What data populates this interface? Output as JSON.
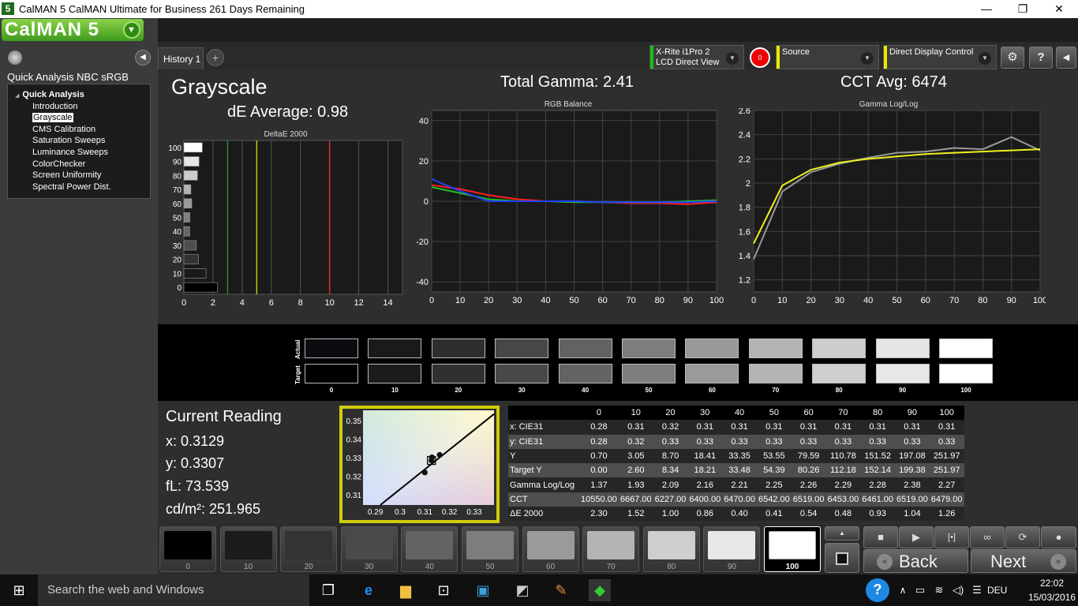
{
  "window": {
    "title": "CalMAN 5 CalMAN Ultimate for Business 261 Days Remaining",
    "minimize": "—",
    "maximize": "❐",
    "close": "✕"
  },
  "brand": {
    "name": "CalMAN 5"
  },
  "sidebar": {
    "workflow_title": "Quick Analysis NBC sRGB",
    "root": "Quick Analysis",
    "items": [
      {
        "label": "Introduction"
      },
      {
        "label": "Grayscale"
      },
      {
        "label": "CMS Calibration"
      },
      {
        "label": "Saturation Sweeps"
      },
      {
        "label": "Luminance Sweeps"
      },
      {
        "label": "ColorChecker"
      },
      {
        "label": "Screen Uniformity"
      },
      {
        "label": "Spectral Power Dist."
      }
    ]
  },
  "tabs": {
    "history": "History 1",
    "add": "+"
  },
  "devices": {
    "meter_line1": "X-Rite i1Pro 2",
    "meter_line2": "LCD Direct View",
    "badge": "0",
    "source": "Source",
    "display": "Direct Display Control"
  },
  "header": {
    "page_title": "Grayscale",
    "de_average": "dE Average: 0.98",
    "total_gamma": "Total Gamma: 2.41",
    "cct_avg": "CCT Avg: 6474"
  },
  "charts": {
    "deltae": {
      "title": "DeltaE 2000"
    },
    "rgb": {
      "title": "RGB Balance"
    },
    "gamma": {
      "title": "Gamma Log/Log"
    }
  },
  "chart_data": [
    {
      "type": "bar",
      "title": "DeltaE 2000",
      "orientation": "horizontal",
      "categories": [
        "0",
        "10",
        "20",
        "30",
        "40",
        "50",
        "60",
        "70",
        "80",
        "90",
        "100"
      ],
      "values": [
        2.3,
        1.52,
        1.0,
        0.86,
        0.4,
        0.41,
        0.54,
        0.48,
        0.93,
        1.04,
        1.26
      ],
      "xlim": [
        0,
        15
      ],
      "xticks": [
        "0",
        "2",
        "4",
        "6",
        "8",
        "10",
        "12",
        "14"
      ],
      "thresholds": [
        {
          "value": 3,
          "color": "#2e8b2e"
        },
        {
          "value": 5,
          "color": "#c8c800"
        },
        {
          "value": 10,
          "color": "#e03030"
        }
      ]
    },
    {
      "type": "line",
      "title": "RGB Balance",
      "x": [
        0,
        10,
        20,
        30,
        40,
        50,
        60,
        70,
        80,
        90,
        100
      ],
      "xticks": [
        "0",
        "10",
        "20",
        "30",
        "40",
        "50",
        "60",
        "70",
        "80",
        "90",
        "100"
      ],
      "yticks": [
        "40",
        "20",
        "0",
        "-20",
        "-40"
      ],
      "ylim": [
        -45,
        45
      ],
      "series": [
        {
          "color": "#ff2020",
          "values": [
            8,
            6,
            3,
            1,
            0,
            0,
            -0.5,
            -1,
            -1,
            -1.5,
            -0.5
          ]
        },
        {
          "color": "#20c020",
          "values": [
            7,
            4,
            1,
            0,
            0,
            -0.5,
            -0.5,
            -0.5,
            -0.5,
            0,
            0.5
          ]
        },
        {
          "color": "#2040ff",
          "values": [
            11,
            5,
            0,
            0,
            0,
            0,
            -0.5,
            -0.5,
            -0.5,
            -0.5,
            0
          ]
        }
      ]
    },
    {
      "type": "line",
      "title": "Gamma Log/Log",
      "x": [
        0,
        10,
        20,
        30,
        40,
        50,
        60,
        70,
        80,
        90,
        100
      ],
      "xticks": [
        "0",
        "10",
        "20",
        "30",
        "40",
        "50",
        "60",
        "70",
        "80",
        "90",
        "100"
      ],
      "yticks": [
        "2.6",
        "2.4",
        "2.2",
        "2",
        "1.8",
        "1.6",
        "1.4",
        "1.2"
      ],
      "ylim": [
        1.1,
        2.6
      ],
      "series": [
        {
          "color": "#9a9a9a",
          "values": [
            1.37,
            1.93,
            2.09,
            2.16,
            2.21,
            2.25,
            2.26,
            2.29,
            2.28,
            2.38,
            2.27
          ]
        },
        {
          "color": "#f0f020",
          "values": [
            1.5,
            1.98,
            2.11,
            2.17,
            2.2,
            2.22,
            2.24,
            2.25,
            2.26,
            2.27,
            2.28
          ]
        }
      ]
    },
    {
      "type": "scatter",
      "title": "",
      "xticks": [
        "0.29",
        "0.3",
        "0.31",
        "0.32",
        "0.33"
      ],
      "yticks": [
        "0.35",
        "0.34",
        "0.33",
        "0.32",
        "0.31"
      ],
      "xlim": [
        0.285,
        0.338
      ],
      "ylim": [
        0.305,
        0.356
      ],
      "points": [
        {
          "x": 0.3127,
          "y": 0.329
        },
        {
          "x": 0.3129,
          "y": 0.3307
        },
        {
          "x": 0.316,
          "y": 0.332
        },
        {
          "x": 0.31,
          "y": 0.3225
        }
      ]
    }
  ],
  "swatches": {
    "actual_label": "Actual",
    "target_label": "Target",
    "levels": [
      "0",
      "10",
      "20",
      "30",
      "40",
      "50",
      "60",
      "70",
      "80",
      "90",
      "100"
    ],
    "actual_colors": [
      "#0b0c10",
      "#1a1a1a",
      "#2e2e2e",
      "#474747",
      "#626262",
      "#7d7d7d",
      "#999999",
      "#b3b3b3",
      "#cdcdcd",
      "#e6e6e6",
      "#ffffff"
    ],
    "target_colors": [
      "#000000",
      "#1b1b1b",
      "#303030",
      "#484848",
      "#636363",
      "#7e7e7e",
      "#9a9a9a",
      "#b4b4b4",
      "#cecece",
      "#e7e7e7",
      "#ffffff"
    ]
  },
  "reading": {
    "title": "Current Reading",
    "x": "x: 0.3129",
    "y": "y: 0.3307",
    "fl": "fL: 73.539",
    "cdm2": "cd/m²: 251.965"
  },
  "table": {
    "headers": [
      "",
      "0",
      "10",
      "20",
      "30",
      "40",
      "50",
      "60",
      "70",
      "80",
      "90",
      "100"
    ],
    "rows": [
      [
        "x: CIE31",
        "0.28",
        "0.31",
        "0.32",
        "0.31",
        "0.31",
        "0.31",
        "0.31",
        "0.31",
        "0.31",
        "0.31",
        "0.31"
      ],
      [
        "y: CIE31",
        "0.28",
        "0.32",
        "0.33",
        "0.33",
        "0.33",
        "0.33",
        "0.33",
        "0.33",
        "0.33",
        "0.33",
        "0.33"
      ],
      [
        "Y",
        "0.70",
        "3.05",
        "8.70",
        "18.41",
        "33.35",
        "53.55",
        "79.59",
        "110.78",
        "151.52",
        "197.08",
        "251.97"
      ],
      [
        "Target Y",
        "0.00",
        "2.60",
        "8.34",
        "18.21",
        "33.48",
        "54.39",
        "80.26",
        "112.18",
        "152.14",
        "199.38",
        "251.97"
      ],
      [
        "Gamma Log/Log",
        "1.37",
        "1.93",
        "2.09",
        "2.16",
        "2.21",
        "2.25",
        "2.26",
        "2.29",
        "2.28",
        "2.38",
        "2.27"
      ],
      [
        "CCT",
        "10550.00",
        "6667.00",
        "6227.00",
        "6400.00",
        "6470.00",
        "6542.00",
        "6519.00",
        "6453.00",
        "6461.00",
        "6519.00",
        "6479.00"
      ],
      [
        "ΔE 2000",
        "2.30",
        "1.52",
        "1.00",
        "0.86",
        "0.40",
        "0.41",
        "0.54",
        "0.48",
        "0.93",
        "1.04",
        "1.26"
      ]
    ]
  },
  "bottom_buttons": {
    "levels": [
      "0",
      "10",
      "20",
      "30",
      "40",
      "50",
      "60",
      "70",
      "80",
      "90",
      "100"
    ],
    "colors": [
      "#000000",
      "#1c1c1c",
      "#333333",
      "#4a4a4a",
      "#636363",
      "#7d7d7d",
      "#9a9a9a",
      "#b4b4b4",
      "#cecece",
      "#e8e8e8",
      "#ffffff"
    ],
    "selected": "100"
  },
  "nav": {
    "back": "Back",
    "next": "Next"
  },
  "taskbar": {
    "search_placeholder": "Search the web and Windows",
    "lang": "DEU",
    "time": "22:02",
    "date": "15/03/2016"
  }
}
